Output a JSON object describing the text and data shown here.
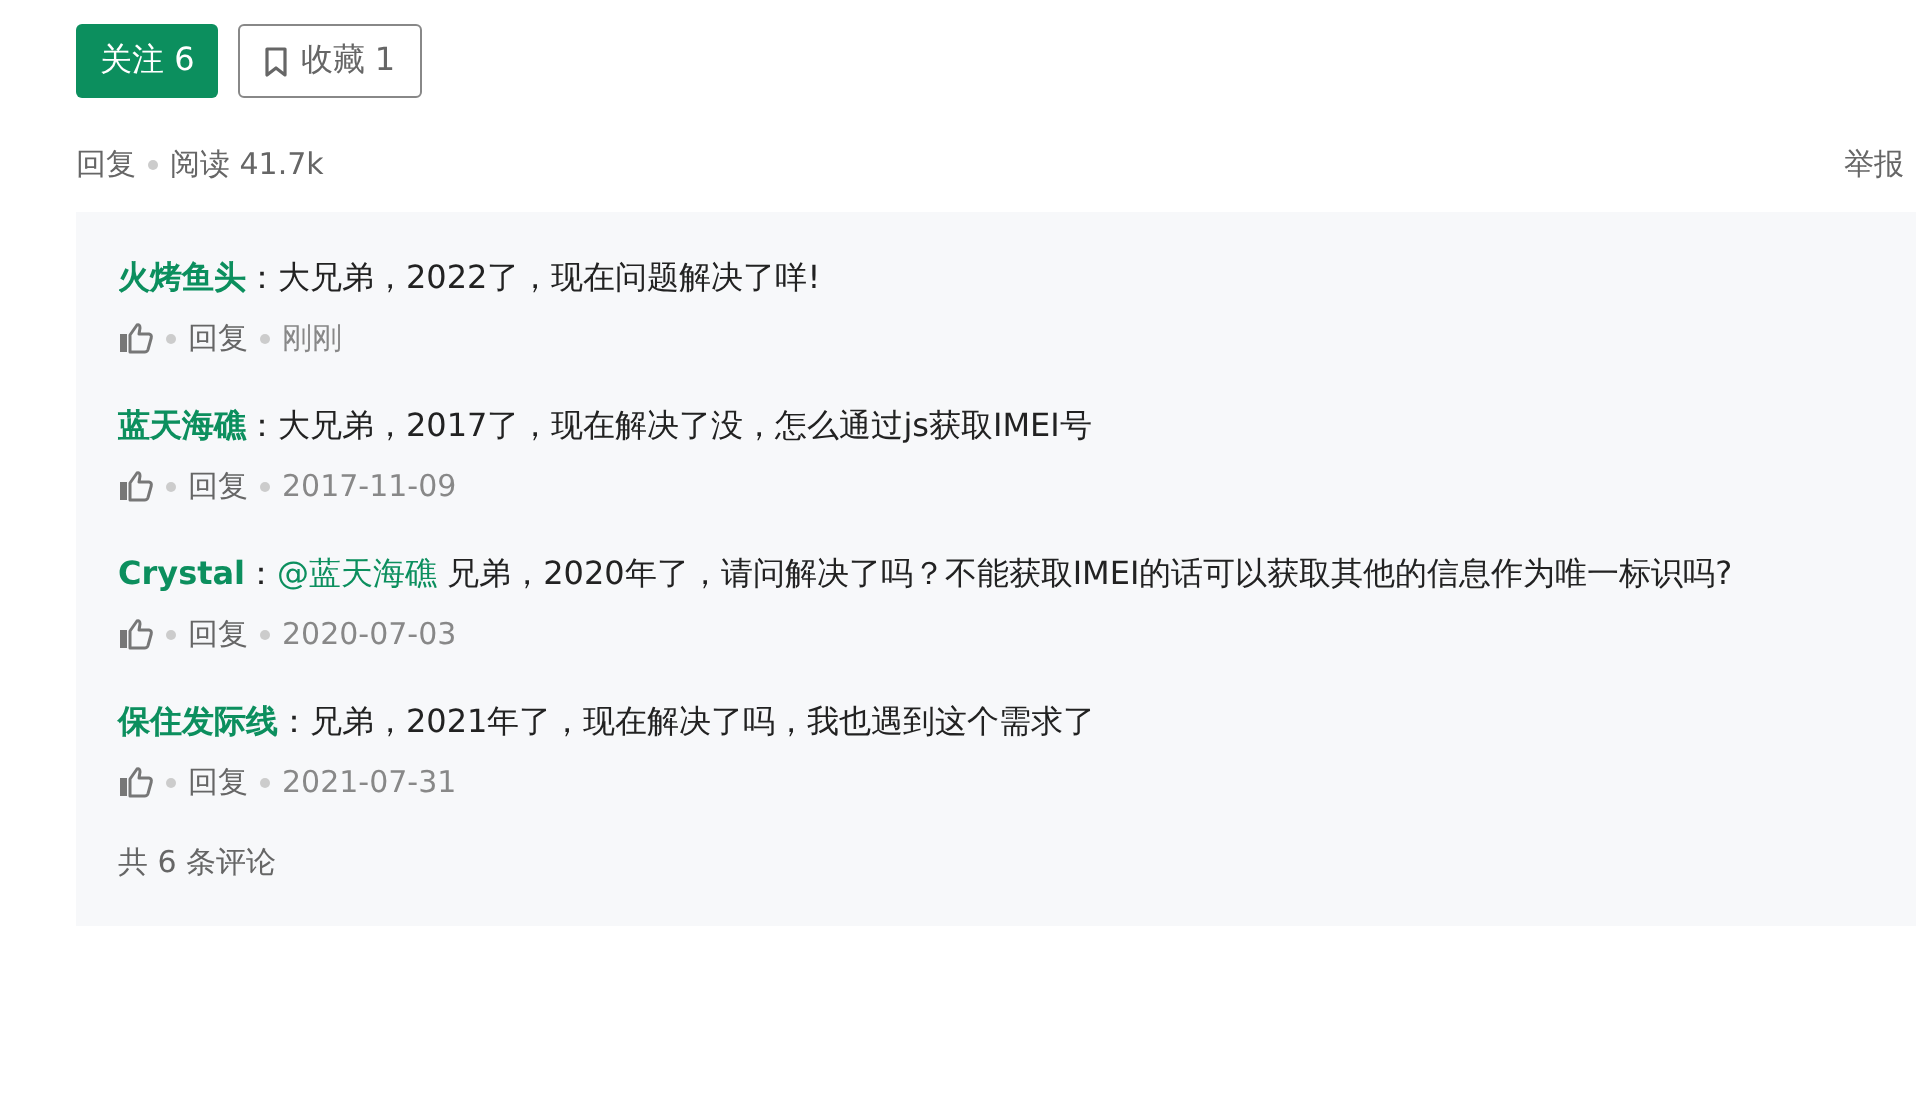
{
  "follow_button": {
    "label": "关注 6"
  },
  "collect_button": {
    "label": "收藏 1"
  },
  "meta": {
    "reply": "回复",
    "reads": "阅读 41.7k",
    "report": "举报"
  },
  "comments": [
    {
      "author": "火烤鱼头",
      "text": "：大兄弟，2022了，现在问题解决了咩!",
      "reply": "回复",
      "time": "刚刚"
    },
    {
      "author": "蓝天海礁",
      "text": "：大兄弟，2017了，现在解决了没，怎么通过js获取IMEI号",
      "reply": "回复",
      "time": "2017-11-09"
    },
    {
      "author": "Crystal",
      "separator": "：",
      "mention": "@蓝天海礁",
      "text": " 兄弟，2020年了，请问解决了吗？不能获取IMEI的话可以获取其他的信息作为唯一标识吗?",
      "reply": "回复",
      "time": "2020-07-03"
    },
    {
      "author": "保住发际线",
      "text": "：兄弟，2021年了，现在解决了吗，我也遇到这个需求了",
      "reply": "回复",
      "time": "2021-07-31"
    }
  ],
  "total": "共 6 条评论"
}
